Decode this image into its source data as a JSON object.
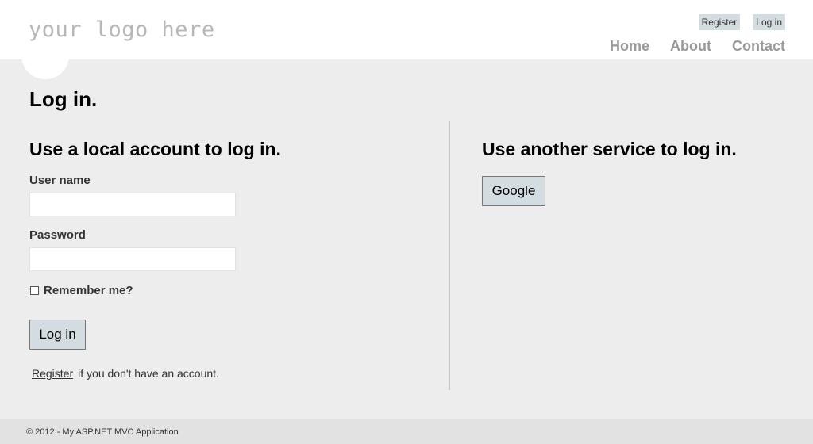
{
  "header": {
    "logo_text": "your logo here",
    "login_links": {
      "register": "Register",
      "login": "Log in"
    },
    "menu": {
      "home": "Home",
      "about": "About",
      "contact": "Contact"
    }
  },
  "main": {
    "title": "Log in.",
    "local": {
      "heading": "Use a local account to log in.",
      "username_label": "User name",
      "username_value": "",
      "password_label": "Password",
      "password_value": "",
      "remember_label": "Remember me?",
      "remember_checked": false,
      "submit_label": "Log in",
      "register_link": "Register",
      "register_suffix": "if you don't have an account."
    },
    "external": {
      "heading": "Use another service to log in.",
      "providers": [
        "Google"
      ]
    }
  },
  "footer": {
    "text": "© 2012 - My ASP.NET MVC Application"
  },
  "colors": {
    "page_background": "#ededed",
    "header_background": "#ffffff",
    "button_background": "#d3dce0",
    "nav_text": "#999999",
    "logo_text": "#b7b7b7"
  }
}
